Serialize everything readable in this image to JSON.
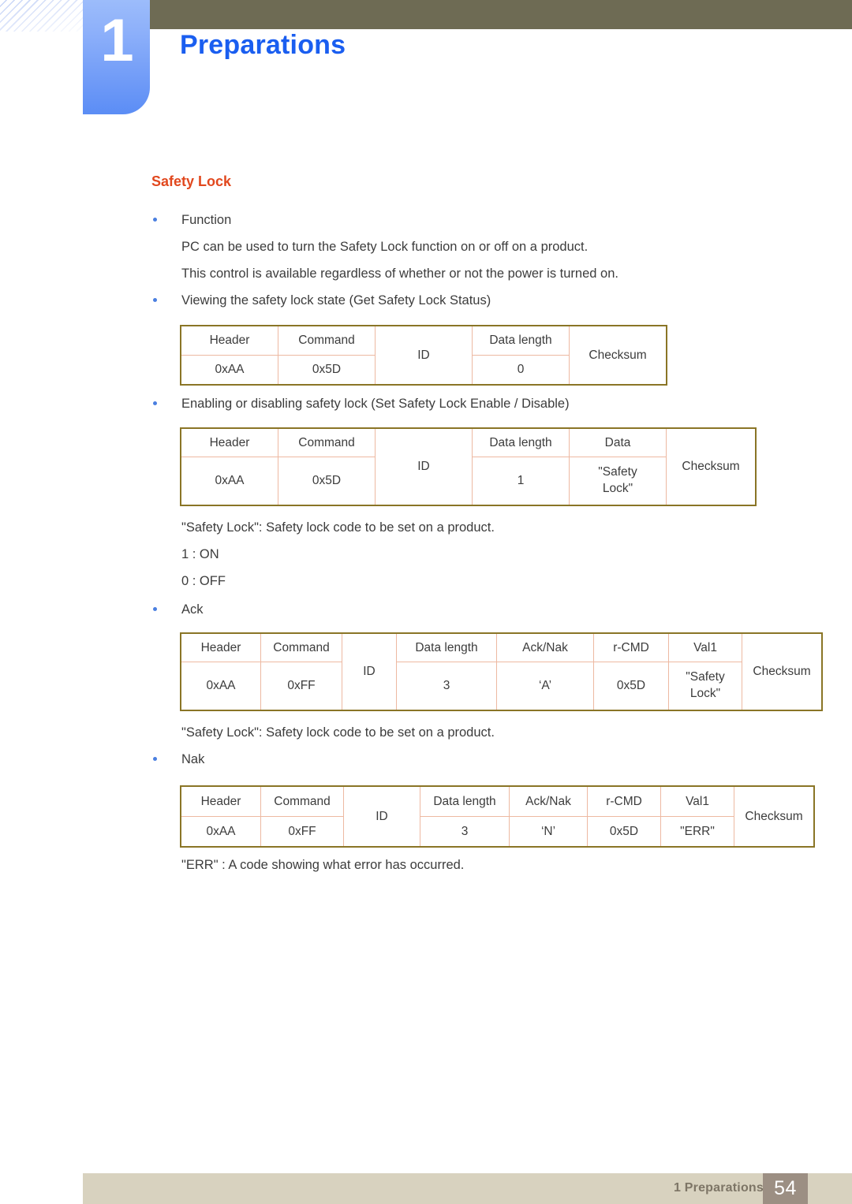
{
  "header": {
    "chapter_number": "1",
    "chapter_title": "Preparations",
    "accent_blue": "#1a5ef0",
    "olive_bar_color": "#6e6b54",
    "tab_color": "#7fa5f8"
  },
  "section": {
    "title": "Safety Lock",
    "title_color": "#e1481e"
  },
  "content": {
    "function_bullet": "Function",
    "function_line1": "PC can be used to turn the Safety Lock function on or off on a product.",
    "function_line2": "This control is available regardless of whether or not the power is turned on.",
    "get_bullet": "Viewing the safety lock state (Get Safety Lock Status)",
    "set_bullet": "Enabling or disabling safety lock (Set Safety Lock Enable / Disable)",
    "safety_lock_note_1": "\"Safety Lock\": Safety lock code to be set on a product.",
    "on_value": "1 : ON",
    "off_value": "0 : OFF",
    "ack_bullet": "Ack",
    "safety_lock_note_2": "\"Safety Lock\": Safety lock code to be set on a product.",
    "nak_bullet": "Nak",
    "err_note": "\"ERR\" : A code showing what error has occurred."
  },
  "tables": {
    "get_status": {
      "headers": [
        "Header",
        "Command",
        "ID",
        "Data length",
        "Checksum"
      ],
      "values": [
        "0xAA",
        "0x5D",
        "0"
      ],
      "id_label": "ID",
      "checksum_label": "Checksum"
    },
    "set_enable": {
      "headers": [
        "Header",
        "Command",
        "ID",
        "Data length",
        "Data",
        "Checksum"
      ],
      "values": [
        "0xAA",
        "0x5D",
        "1"
      ],
      "data_value_line1": "\"Safety",
      "data_value_line2": "Lock\"",
      "id_label": "ID",
      "checksum_label": "Checksum"
    },
    "ack": {
      "headers": [
        "Header",
        "Command",
        "ID",
        "Data length",
        "Ack/Nak",
        "r-CMD",
        "Val1",
        "Checksum"
      ],
      "values": [
        "0xAA",
        "0xFF",
        "3",
        "‘A’",
        "0x5D"
      ],
      "val1_line1": "\"Safety",
      "val1_line2": "Lock\"",
      "id_label": "ID",
      "checksum_label": "Checksum"
    },
    "nak": {
      "headers": [
        "Header",
        "Command",
        "ID",
        "Data length",
        "Ack/Nak",
        "r-CMD",
        "Val1",
        "Checksum"
      ],
      "values": [
        "0xAA",
        "0xFF",
        "3",
        "‘N’",
        "0x5D",
        "\"ERR\""
      ],
      "id_label": "ID",
      "checksum_label": "Checksum"
    },
    "border_outer_color": "#8a7526",
    "border_inner_color": "#edb9a2"
  },
  "footer": {
    "label": "1 Preparations",
    "page_number": "54",
    "bar_color": "#d8d2bf",
    "page_box_color": "#9c8f83"
  }
}
